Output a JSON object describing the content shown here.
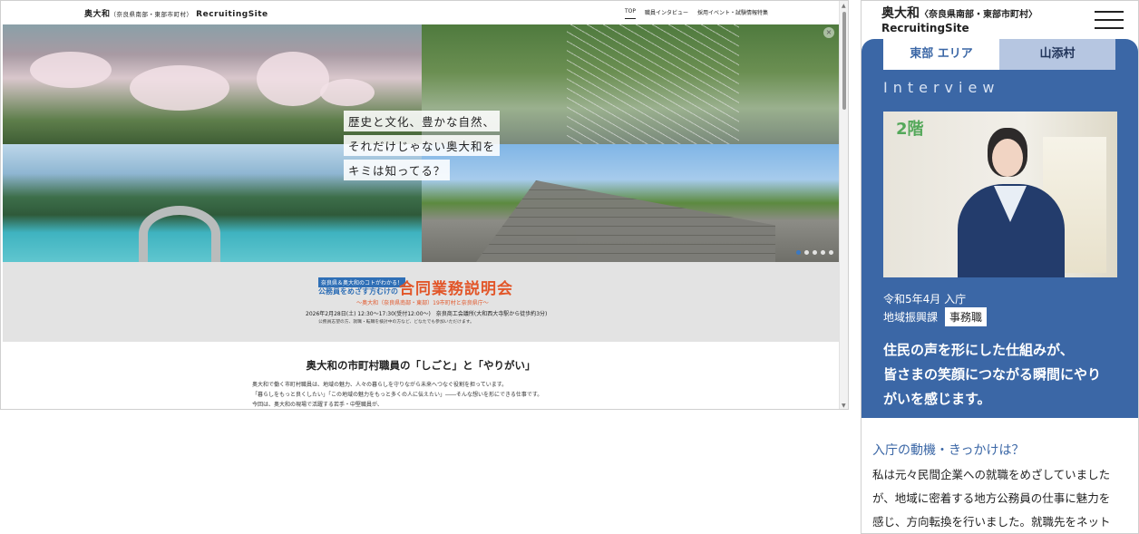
{
  "desktop": {
    "site": {
      "name": "奥大和",
      "area": "（奈良県南部・東部市町村）",
      "suffix": "RecruitingSite"
    },
    "nav": [
      {
        "label": "TOP",
        "active": true
      },
      {
        "label": "職員インタビュー",
        "active": false
      },
      {
        "label": "採用イベント・試験情報特集",
        "active": false
      }
    ],
    "hero": {
      "catch_lines": [
        "歴史と文化、豊かな自然、",
        "それだけじゃない奥大和を",
        "キミは知ってる？"
      ],
      "slides": 5,
      "active_slide": 1,
      "close_icon": "×"
    },
    "banner": {
      "tag": "奈良県＆奥大和のコトがわかる！",
      "target": "公務員をめざす方むけの",
      "title": "合同業務説明会",
      "subtitle": "～奥大和（奈良県南部・東部）19市町村と奈良県庁～",
      "datetime": "2026年2月28日(土) 12:30～17:30(受付12:00～)　奈良商工会議所(大和西大寺駅から徒歩約3分)",
      "note": "公務員志望の方、就職・転職を検討中の方など、どなたでも参加いただけます。"
    },
    "concept": {
      "heading": "奥大和の市町村職員の「しごと」と「やりがい」",
      "paragraphs": [
        "奥大和で働く市町村職員は、地域の魅力、人々の暮らしを守りながら未来へつなぐ役割を担っています。",
        "「暮らしをもっと良くしたい」「この地域の魅力をもっと多くの人に伝えたい」――そんな想いを形にできる仕事です。",
        "今回は、奥大和の現場で活躍する若手・中堅職員が、"
      ]
    },
    "scrollbar": {
      "up": "▲",
      "down": "▼"
    }
  },
  "mobile": {
    "site": {
      "name": "奥大和",
      "area": "〈奈良県南部・東部市町村〉",
      "suffix": "RecruitingSite"
    },
    "tabs": [
      "東部 エリア",
      "山添村"
    ],
    "section_label": "Interview",
    "photo_sign": "2階",
    "profile": {
      "joined": "令和5年4月 入庁",
      "department": "地域振興課",
      "role_badge": "事務職"
    },
    "quote_lines": [
      "住民の声を形にした仕組みが、",
      "皆さまの笑顔につながる瞬間にやり",
      "がいを感じます。"
    ],
    "motive": {
      "question": "入庁の動機・きっかけは？",
      "lines": [
        "私は元々民間企業への就職をめざしていました",
        "が、地域に密着する地方公務員の仕事に魅力を",
        "感じ、方向転換を行いました。就職先をネット"
      ]
    }
  },
  "colors": {
    "accent_blue": "#3b67a6",
    "banner_orange": "#e2572a",
    "active_dot": "#3a78c2"
  },
  "icons": {
    "menu": "hamburger-icon",
    "close": "close-icon",
    "scroll": "scroll-arrow-icon"
  }
}
